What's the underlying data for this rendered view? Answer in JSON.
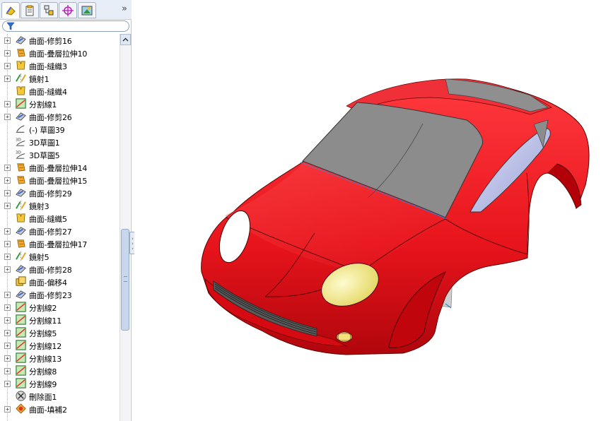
{
  "panel": {
    "tabs": [
      {
        "name": "feature-manager-tab",
        "icon": "feature-tree-icon"
      },
      {
        "name": "property-manager-tab",
        "icon": "property-icon"
      },
      {
        "name": "configuration-manager-tab",
        "icon": "configuration-icon"
      },
      {
        "name": "dimxpert-manager-tab",
        "icon": "crosshair-icon"
      },
      {
        "name": "display-manager-tab",
        "icon": "display-icon"
      }
    ],
    "more": "»",
    "filter_icon": "filter-icon"
  },
  "tree": {
    "items": [
      {
        "label": "曲面-修剪16",
        "icon": "surface-trim-icon",
        "expand": "+"
      },
      {
        "label": "曲面-疊層拉伸10",
        "icon": "surface-loft-icon",
        "expand": "+"
      },
      {
        "label": "曲面-縫織3",
        "icon": "surface-knit-icon",
        "expand": "+"
      },
      {
        "label": "鏡射1",
        "icon": "mirror-icon",
        "expand": "+"
      },
      {
        "label": "曲面-縫織4",
        "icon": "surface-knit-icon",
        "expand": ""
      },
      {
        "label": "分割線1",
        "icon": "split-line-icon",
        "expand": "+"
      },
      {
        "label": "曲面-修剪26",
        "icon": "surface-trim-icon",
        "expand": "+"
      },
      {
        "label": "(-) 草圖39",
        "icon": "sketch-icon",
        "expand": ""
      },
      {
        "label": "3D草圖1",
        "icon": "sketch-3d-icon",
        "expand": ""
      },
      {
        "label": "3D草圖5",
        "icon": "sketch-3d-icon",
        "expand": ""
      },
      {
        "label": "曲面-疊層拉伸14",
        "icon": "surface-loft-icon",
        "expand": "+"
      },
      {
        "label": "曲面-疊層拉伸15",
        "icon": "surface-loft-icon",
        "expand": "+"
      },
      {
        "label": "曲面-修剪29",
        "icon": "surface-trim-icon",
        "expand": "+"
      },
      {
        "label": "鏡射3",
        "icon": "mirror-icon",
        "expand": "+"
      },
      {
        "label": "曲面-縫織5",
        "icon": "surface-knit-icon",
        "expand": ""
      },
      {
        "label": "曲面-修剪27",
        "icon": "surface-trim-icon",
        "expand": "+"
      },
      {
        "label": "曲面-疊層拉伸17",
        "icon": "surface-loft-icon",
        "expand": "+"
      },
      {
        "label": "鏡射5",
        "icon": "mirror-icon",
        "expand": "+"
      },
      {
        "label": "曲面-修剪28",
        "icon": "surface-trim-icon",
        "expand": "+"
      },
      {
        "label": "曲面-偏移4",
        "icon": "surface-offset-icon",
        "expand": ""
      },
      {
        "label": "曲面-修剪23",
        "icon": "surface-trim-icon",
        "expand": "+"
      },
      {
        "label": "分割線2",
        "icon": "split-line-icon",
        "expand": "+"
      },
      {
        "label": "分割線11",
        "icon": "split-line-icon",
        "expand": "+"
      },
      {
        "label": "分割線5",
        "icon": "split-line-icon",
        "expand": "+"
      },
      {
        "label": "分割線12",
        "icon": "split-line-icon",
        "expand": "+"
      },
      {
        "label": "分割線13",
        "icon": "split-line-icon",
        "expand": "+"
      },
      {
        "label": "分割線8",
        "icon": "split-line-icon",
        "expand": "+"
      },
      {
        "label": "分割線9",
        "icon": "split-line-icon",
        "expand": "+"
      },
      {
        "label": "刪除面1",
        "icon": "delete-face-icon",
        "expand": ""
      },
      {
        "label": "曲面-填補2",
        "icon": "surface-fill-icon",
        "expand": "+"
      }
    ]
  },
  "viewport": {
    "model": "car-body-surface-model",
    "colors": {
      "body": "#e8141c",
      "glass": "#8c8c8c",
      "side_window": "#b9bde6",
      "headlight": "#e8e07a",
      "inner_panel": "#d0d0d0"
    }
  }
}
